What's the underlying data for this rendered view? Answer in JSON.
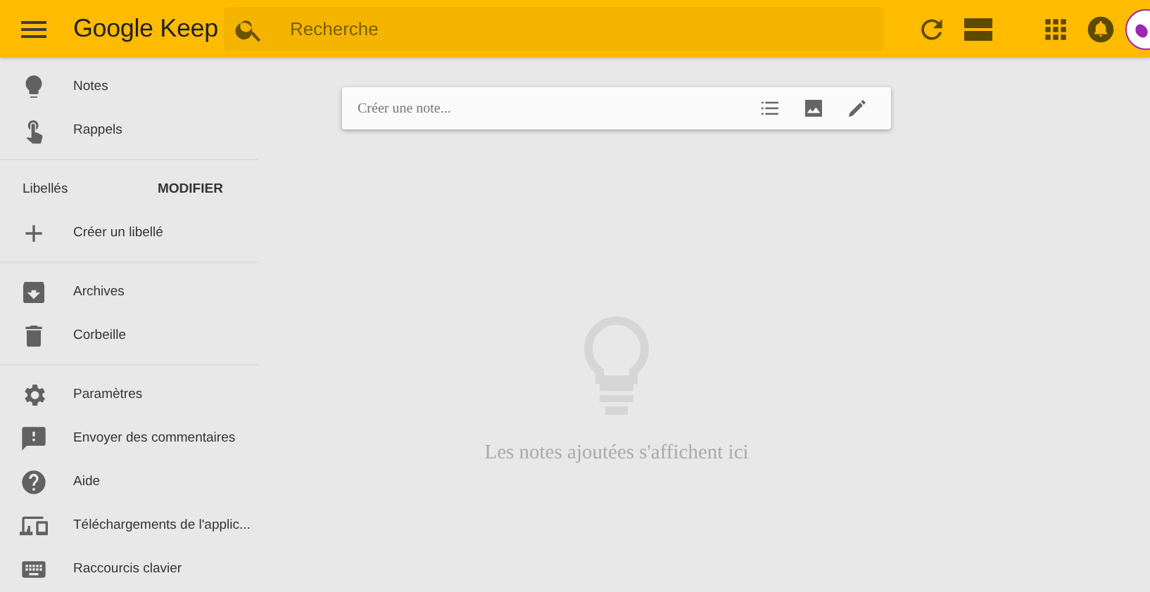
{
  "header": {
    "logo": "Google Keep",
    "search": {
      "placeholder": "Recherche"
    }
  },
  "sidebar": {
    "sections": [
      {
        "items": [
          {
            "label": "Notes"
          },
          {
            "label": "Rappels"
          }
        ]
      },
      {
        "header": {
          "label": "Libellés",
          "action": "MODIFIER"
        },
        "items": [
          {
            "label": "Créer un libellé"
          }
        ]
      },
      {
        "items": [
          {
            "label": "Archives"
          },
          {
            "label": "Corbeille"
          }
        ]
      },
      {
        "items": [
          {
            "label": "Paramètres"
          },
          {
            "label": "Envoyer des commentaires"
          },
          {
            "label": "Aide"
          },
          {
            "label": "Téléchargements de l'applic..."
          },
          {
            "label": "Raccourcis clavier"
          }
        ]
      }
    ]
  },
  "note_bar": {
    "placeholder": "Créer une note..."
  },
  "empty_state": {
    "message": "Les notes ajoutées s'affichent ici"
  }
}
